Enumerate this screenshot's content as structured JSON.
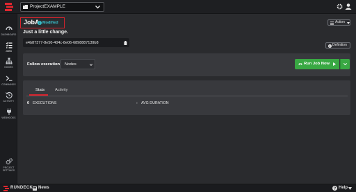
{
  "topbar": {
    "project_name": "ProjectEXAMPLE",
    "icons": {
      "logo": "rundeck-logo-icon",
      "folder": "folder-icon",
      "gear": "gear-icon",
      "user": "user-icon"
    }
  },
  "sidebar": {
    "items": [
      {
        "label": "Dashboard",
        "icon": "dashboard-icon",
        "active": false
      },
      {
        "label": "Jobs",
        "icon": "jobs-list-icon",
        "active": true
      },
      {
        "label": "Nodes",
        "icon": "nodes-icon",
        "active": false
      },
      {
        "label": "Commands",
        "icon": "terminal-icon",
        "active": false
      },
      {
        "label": "Activity",
        "icon": "history-icon",
        "active": false
      },
      {
        "label": "Webhooks",
        "icon": "plug-icon",
        "active": false
      }
    ],
    "settings_label_line1": "Project",
    "settings_label_line2": "Settings"
  },
  "job": {
    "name": "JobA",
    "status_badge": "Modified",
    "description": "Just a little change.",
    "uuid": "e4b87377-8e50-404c-8e06-6898887139b8",
    "action_label": "Action",
    "definition_label": "Definition"
  },
  "run": {
    "follow_label": "Follow execution",
    "follow_value": "Nodes",
    "run_label": "Run Job Now",
    "accent_color": "#39a843"
  },
  "stats": {
    "tabs": [
      "Stats",
      "Activity"
    ],
    "active_tab": "Stats",
    "executions_count": "0",
    "executions_label": "EXECUTIONS",
    "avg_duration_value": "-",
    "avg_duration_label": "AVG DURATION"
  },
  "bottombar": {
    "brand": "RUNDECK",
    "news_label": "News",
    "help_label": "Help"
  },
  "colors": {
    "highlight_border": "#d9232d",
    "modified_badge": "#38c2cf"
  }
}
